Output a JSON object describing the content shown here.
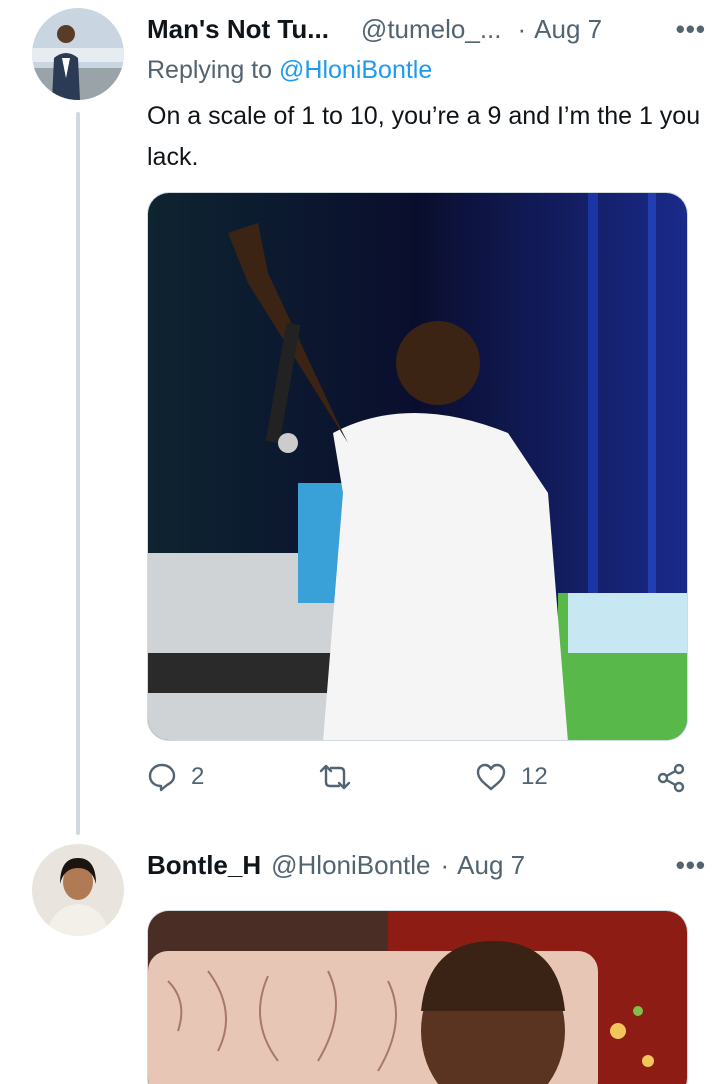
{
  "tweet1": {
    "name": "Man's Not Tu...",
    "handle": "@tumelo_...",
    "separator": "·",
    "date": "Aug 7",
    "more": "•••",
    "replying_prefix": "Replying to ",
    "replying_handle": "@HloniBontle",
    "text": "On a scale of 1 to 10, you’re a 9 and I’m the 1 you lack.",
    "reply_count": "2",
    "retweet_count": "",
    "like_count": "12"
  },
  "tweet2": {
    "name": "Bontle_H",
    "handle": "@HloniBontle",
    "separator": "·",
    "date": "Aug 7",
    "more": "•••"
  },
  "icons": [
    "reply-icon",
    "retweet-icon",
    "like-icon",
    "share-icon",
    "more-icon"
  ],
  "colors": {
    "link": "#1d9bf0",
    "muted": "#536471",
    "text": "#0f1419",
    "thread_line": "#cfd9de"
  }
}
